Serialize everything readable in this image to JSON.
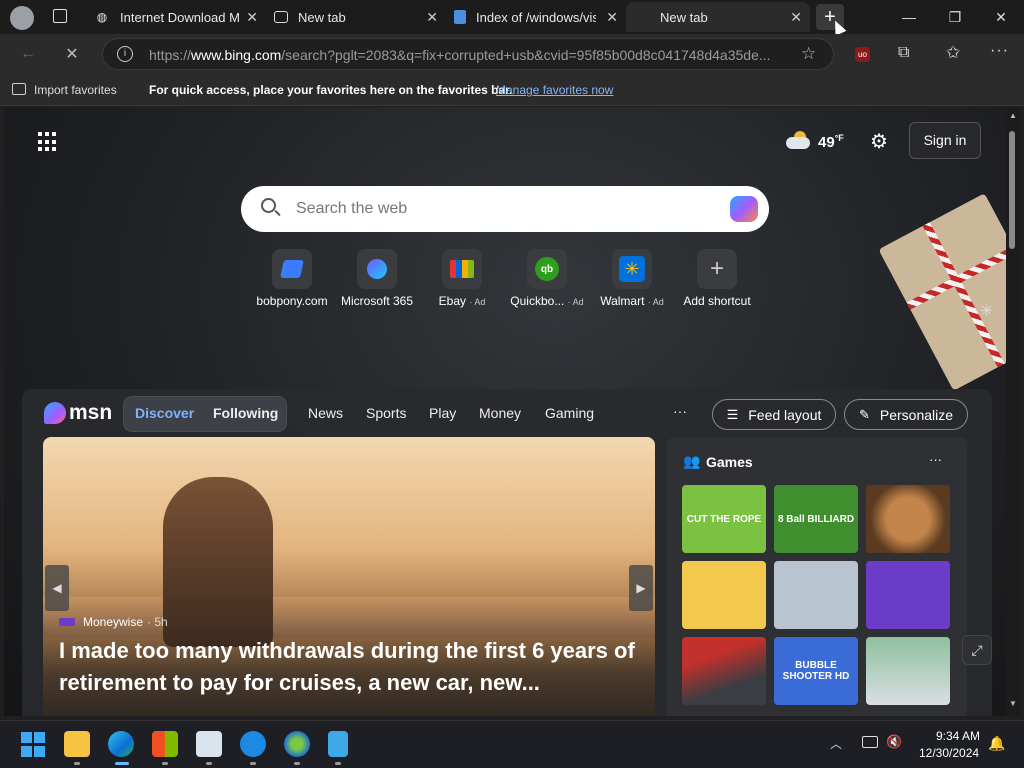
{
  "tabs": [
    {
      "title": "Internet Download Ma",
      "icon": "globe-icon"
    },
    {
      "title": "New tab",
      "icon": "newtab-icon"
    },
    {
      "title": "Index of /windows/vist",
      "icon": "document-icon"
    },
    {
      "title": "New tab",
      "icon": "newtab-icon",
      "active": true
    }
  ],
  "address": {
    "url_prefix": "https://",
    "url_host": "www.bing.com",
    "url_rest": "/search?pglt=2083&q=fix+corrupted+usb&cvid=95f85b00d8c041748d4a35de..."
  },
  "favorites_bar": {
    "import_label": "Import favorites",
    "hint": "For quick access, place your favorites here on the favorites bar.",
    "manage_link": "Manage favorites now"
  },
  "header": {
    "temperature": "49",
    "temp_unit": "°F",
    "sign_in": "Sign in"
  },
  "search": {
    "placeholder": "Search the web"
  },
  "shortcuts": [
    {
      "label": "bobpony.com",
      "ad": "",
      "color": "#3b7cff"
    },
    {
      "label": "Microsoft 365",
      "ad": "",
      "color": "#7b5cff"
    },
    {
      "label": "Ebay",
      "ad": "· Ad",
      "color": "#e53238"
    },
    {
      "label": "Quickbo...",
      "ad": "· Ad",
      "color": "#2ca01c"
    },
    {
      "label": "Walmart",
      "ad": "· Ad",
      "color": "#0071dc"
    },
    {
      "label": "Add shortcut",
      "ad": "",
      "color": "#cccccc"
    }
  ],
  "feed": {
    "logo": "msn",
    "discover": "Discover",
    "following": "Following",
    "nav": [
      "News",
      "Sports",
      "Play",
      "Money",
      "Gaming"
    ],
    "more": "···",
    "feed_layout": "Feed layout",
    "personalize": "Personalize"
  },
  "hero": {
    "source": "Moneywise",
    "age": "· 5h",
    "headline": "I made too many withdrawals during the first 6 years of retirement to pay for cruises, a new car, new..."
  },
  "games": {
    "title": "Games",
    "more": "···",
    "tiles": [
      {
        "label": "CUT THE ROPE",
        "bg": "#7cc242"
      },
      {
        "label": "8 Ball BILLIARD",
        "bg": "#3f8f2f"
      },
      {
        "label": "",
        "bg": "#9a6a3a"
      },
      {
        "label": "",
        "bg": "#f2c94c"
      },
      {
        "label": "",
        "bg": "#b8c4cf"
      },
      {
        "label": "",
        "bg": "#6a3cc7"
      },
      {
        "label": "",
        "bg": "#5a5f66"
      },
      {
        "label": "BUBBLE SHOOTER HD",
        "bg": "#3b6bd6"
      },
      {
        "label": "",
        "bg": "#8fc0a0"
      }
    ]
  },
  "taskbar": {
    "time": "9:34 AM",
    "date": "12/30/2024"
  }
}
